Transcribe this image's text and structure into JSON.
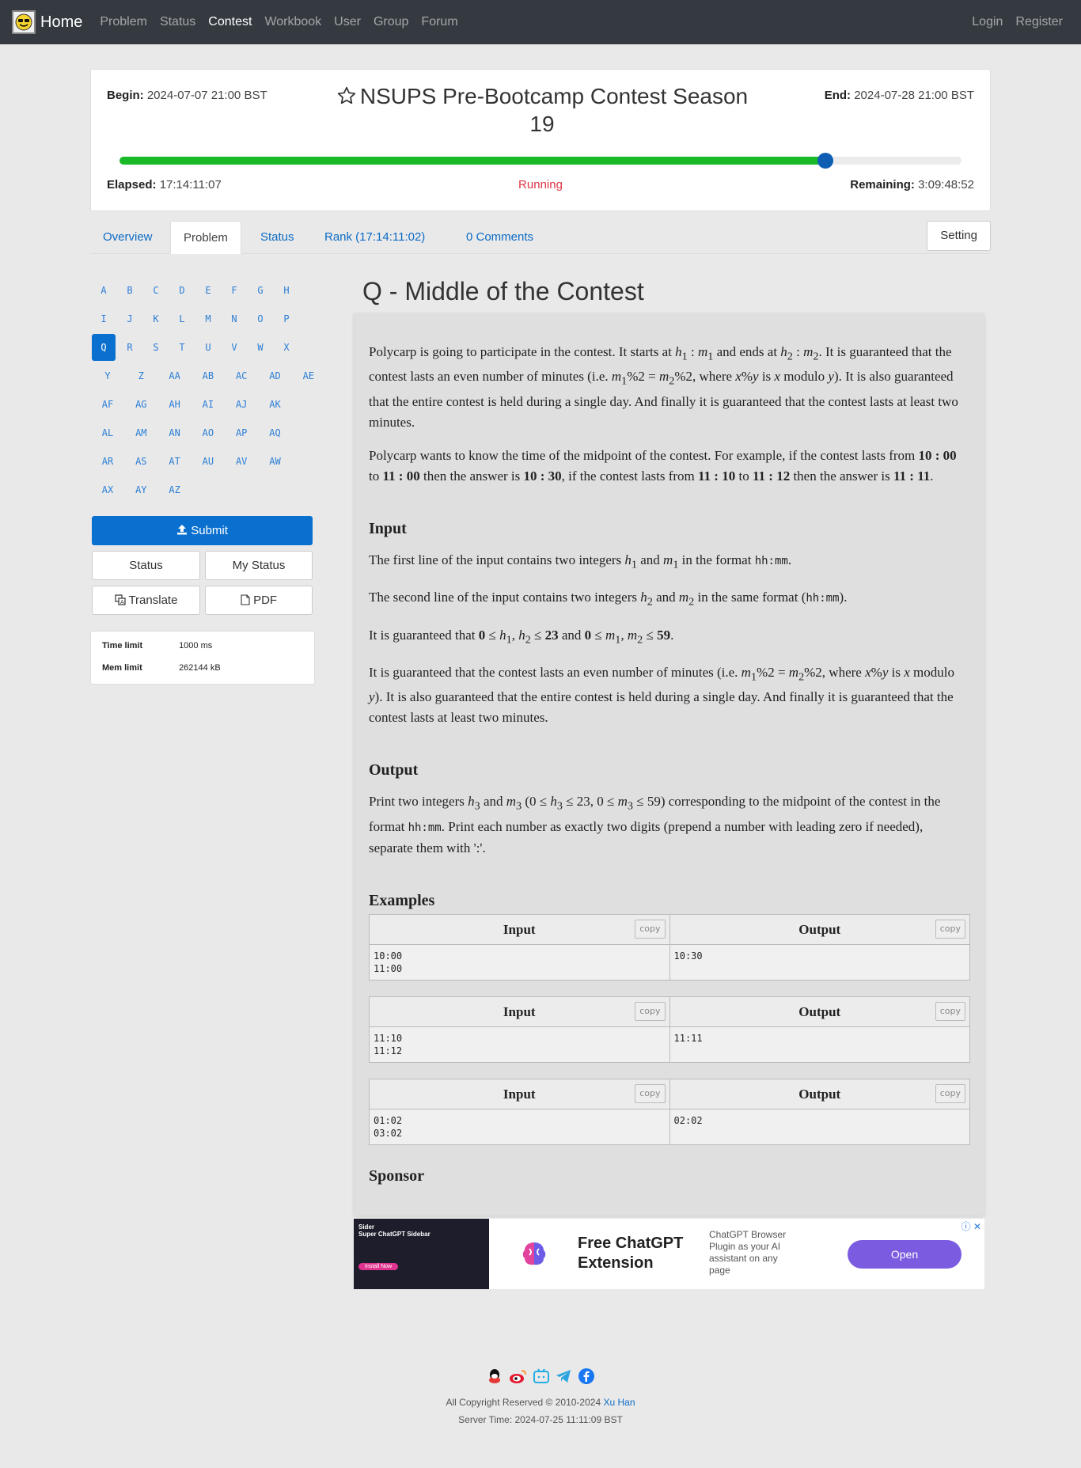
{
  "nav": {
    "brand": "Home",
    "items": [
      "Problem",
      "Status",
      "Contest",
      "Workbook",
      "User",
      "Group",
      "Forum"
    ],
    "active": "Contest",
    "right": [
      "Login",
      "Register"
    ]
  },
  "contest": {
    "title": "NSUPS Pre-Bootcamp Contest Season 19",
    "begin_label": "Begin:",
    "begin": "2024-07-07 21:00 BST",
    "end_label": "End:",
    "end": "2024-07-28 21:00 BST",
    "elapsed_label": "Elapsed:",
    "elapsed": "17:14:11:07",
    "remaining_label": "Remaining:",
    "remaining": "3:09:48:52",
    "status": "Running",
    "progress": 0.838,
    "progress_color": "#19b927"
  },
  "tabs": {
    "items": [
      "Overview",
      "Problem",
      "Status",
      "Rank (17:14:11:02)",
      "0 Comments"
    ],
    "active": "Problem",
    "setting": "Setting"
  },
  "sidebar": {
    "letters": [
      [
        "A",
        "B",
        "C",
        "D",
        "E",
        "F",
        "G",
        "H"
      ],
      [
        "I",
        "J",
        "K",
        "L",
        "M",
        "N",
        "O",
        "P"
      ],
      [
        "Q",
        "R",
        "S",
        "T",
        "U",
        "V",
        "W",
        "X"
      ],
      [
        "Y",
        "Z",
        "AA",
        "AB",
        "AC",
        "AD",
        "AE"
      ],
      [
        "AF",
        "AG",
        "AH",
        "AI",
        "AJ",
        "AK"
      ],
      [
        "AL",
        "AM",
        "AN",
        "AO",
        "AP",
        "AQ"
      ],
      [
        "AR",
        "AS",
        "AT",
        "AU",
        "AV",
        "AW"
      ],
      [
        "AX",
        "AY",
        "AZ"
      ]
    ],
    "active_letter": "Q",
    "submit": "Submit",
    "status": "Status",
    "my_status": "My Status",
    "translate": "Translate",
    "pdf": "PDF",
    "time_limit_label": "Time limit",
    "time_limit": "1000 ms",
    "mem_limit_label": "Mem limit",
    "mem_limit": "262144 kB"
  },
  "problem": {
    "title": "Q - Middle of the Contest",
    "input_heading": "Input",
    "output_heading": "Output",
    "examples_heading": "Examples",
    "sponsor_heading": "Sponsor",
    "examples": [
      {
        "input": "10:00\n11:00",
        "output": "10:30"
      },
      {
        "input": "11:10\n11:12",
        "output": "11:11"
      },
      {
        "input": "01:02\n03:02",
        "output": "02:02"
      }
    ],
    "ex_input_label": "Input",
    "ex_output_label": "Output",
    "copy_label": "copy"
  },
  "ad": {
    "title": "Free ChatGPT Extension",
    "desc": "ChatGPT Browser Plugin as your AI assistant on any page",
    "open": "Open",
    "thumb_title": "Sider",
    "thumb_sub": "Super ChatGPT Sidebar",
    "thumb_cta": "Install Now"
  },
  "footer": {
    "copyright_prefix": "All Copyright Reserved © 2010-2024",
    "author": "Xu Han",
    "server_time": "Server Time: 2024-07-25 11:11:09 BST"
  }
}
